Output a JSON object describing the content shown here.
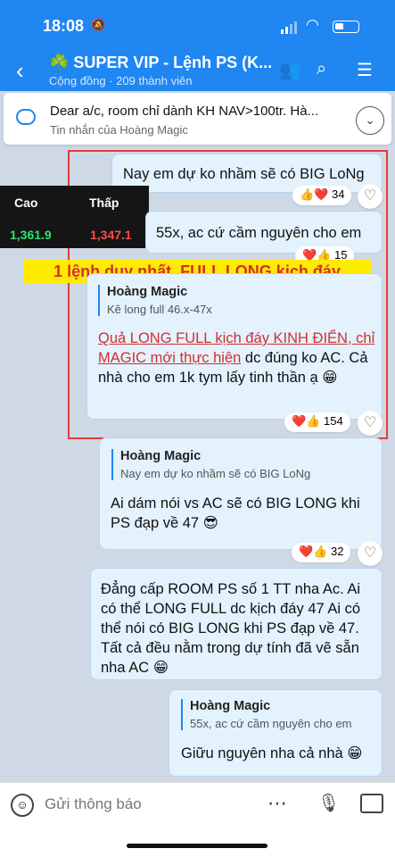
{
  "status_bar": {
    "time": "18:08"
  },
  "header": {
    "back": "‹",
    "title": "☘️ SUPER VIP - Lệnh PS (K...",
    "subtitle": "Cộng đồng · 209 thành viên",
    "icons": [
      "add-member-icon",
      "search-icon",
      "menu-icon"
    ]
  },
  "pinned": {
    "text": "Dear a/c, room chỉ dành KH NAV>100tr. Hà...",
    "sub": "Tin nhắn của Hoàng Magic"
  },
  "ticker": {
    "col1": "Cao",
    "col2": "Thấp",
    "val1": "1,361.9",
    "val2": "1,347.1"
  },
  "banner": "1 lệnh duy nhất, FULL LONG kịch đáy",
  "messages": [
    {
      "text": "Nay em dự ko nhầm sẽ có BIG LoNg",
      "reactions": "👍❤️ 34"
    },
    {
      "text": "55x, ac cứ cầm nguyên cho em",
      "reactions": "❤️👍 15"
    },
    {
      "quote_name": "Hoàng Magic",
      "quote_text": "Kê long full 46.x-47x",
      "highlight": "Quả LONG FULL kịch đáy KINH ĐIỂN, chỉ MAGIC mới thực hiện",
      "text_rest": " dc đúng ko AC. Cả nhà cho em 1k tym lấy tinh thần ạ 😁",
      "reactions": "❤️👍 154"
    },
    {
      "quote_name": "Hoàng Magic",
      "quote_text": "Nay em dự ko nhầm sẽ có BIG LoNg",
      "text": "Ai dám nói vs AC sẽ có BIG LONG khi PS đạp về 47 😎",
      "reactions": "❤️👍 32"
    },
    {
      "text": "Đẳng cấp ROOM PS số 1 TT nha Ac. Ai có thể LONG FULL dc kịch đáy 47 Ai có thể nói có BIG LONG khi PS đạp về 47. Tất cả đều nằm trong dự tính đã vẽ sẵn nha AC 😁"
    },
    {
      "quote_name": "Hoàng Magic",
      "quote_text": "55x, ac cứ cầm nguyên cho em",
      "text": "Giữu nguyên nha cả nhà 😁"
    }
  ],
  "input": {
    "placeholder": "Gửi thông báo"
  }
}
